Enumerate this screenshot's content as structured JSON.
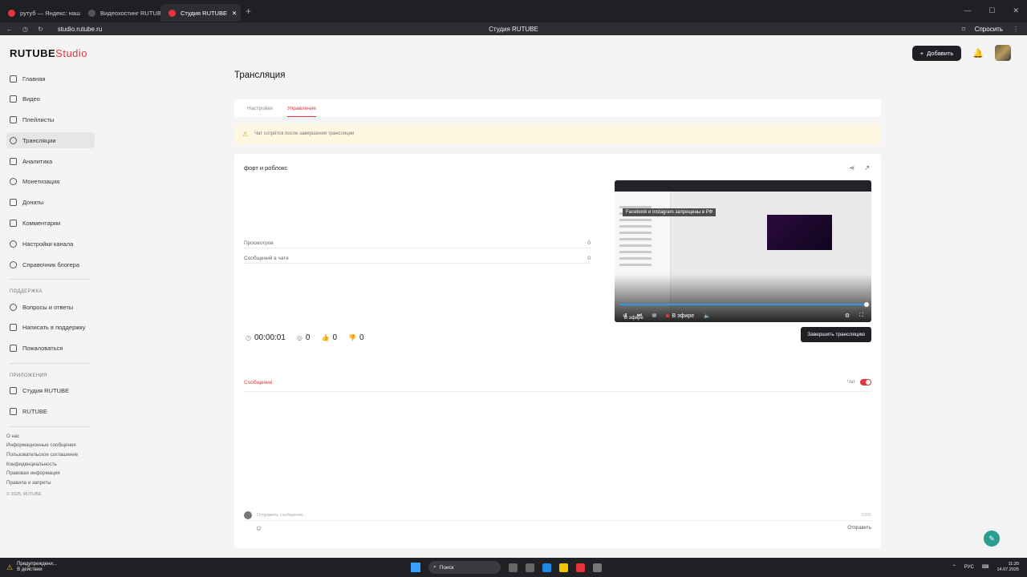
{
  "browser": {
    "tabs": [
      {
        "label": "рутуб — Яндекс: нашлось"
      },
      {
        "label": "Видеохостинг RUTUBE. С"
      },
      {
        "label": "Студия RUTUBE"
      }
    ],
    "url": "studio.rutube.ru",
    "window_title": "Студия RUTUBE",
    "ask_label": "Спросить"
  },
  "header": {
    "logo": "RUTUBE",
    "logo_suffix": "Studio",
    "add_label": "Добавить"
  },
  "sidebar": {
    "items": [
      {
        "label": "Главная"
      },
      {
        "label": "Видео"
      },
      {
        "label": "Плейлисты"
      },
      {
        "label": "Трансляции"
      },
      {
        "label": "Аналитика"
      },
      {
        "label": "Монетизация"
      },
      {
        "label": "Донаты"
      },
      {
        "label": "Комментарии"
      },
      {
        "label": "Настройки канала"
      },
      {
        "label": "Справочник блогера"
      }
    ],
    "support_title": "ПОДДЕРЖКА",
    "support_items": [
      {
        "label": "Вопросы и ответы"
      },
      {
        "label": "Написать в поддержку"
      },
      {
        "label": "Пожаловаться"
      }
    ],
    "apps_title": "ПРИЛОЖЕНИЯ",
    "apps_items": [
      {
        "label": "Студия RUTUBE"
      },
      {
        "label": "RUTUBE"
      }
    ],
    "footer_links": [
      "О нас",
      "Информационные сообщения",
      "Пользовательское соглашение",
      "Конфиденциальность",
      "Правовая информация",
      "Правила и запреты"
    ],
    "copyright": "© 2025, RUTUBE"
  },
  "main": {
    "title": "Трансляция",
    "tabs": [
      {
        "label": "Настройки"
      },
      {
        "label": "Управление"
      }
    ],
    "notice": "Чат сотрётся после завершения трансляции",
    "stream": {
      "title": "форт и роблокс",
      "stats": [
        {
          "label": "Просмотров",
          "value": "0"
        },
        {
          "label": "Сообщений в чате",
          "value": "0"
        }
      ],
      "duration": "00:00:01",
      "viewers": "0",
      "likes": "0",
      "dislikes": "0",
      "end_label": "Завершить трансляцию"
    },
    "player": {
      "banner": "Facebook и Instagram запрещены в РФ",
      "live_label": "В эфире",
      "live_label2": "В эфире"
    },
    "messages": {
      "title": "Сообщения",
      "chat_label": "Чат",
      "placeholder": "Отправить сообщение...",
      "counter": "0/200",
      "send_label": "Отправить"
    }
  },
  "taskbar": {
    "warning_title": "Предупреждени...",
    "warning_sub": "В действии",
    "search_label": "Поиск",
    "lang": "РУС",
    "time": "11:20",
    "date": "14.07.2025"
  },
  "colors": {
    "accent": "#e5343d",
    "dark": "#1f2023"
  }
}
